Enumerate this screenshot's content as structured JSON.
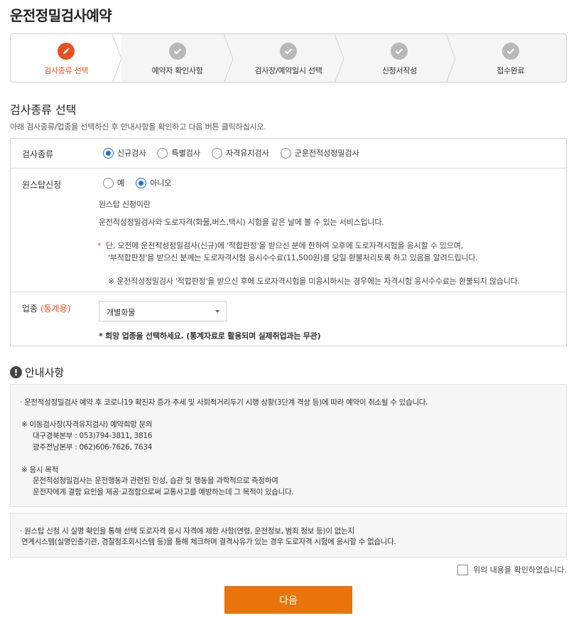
{
  "page_title": "운전정밀검사예약",
  "stepper": {
    "steps": [
      {
        "label": "검사종류 선택",
        "icon": "pencil-icon",
        "active": true
      },
      {
        "label": "예약자 확인사항",
        "icon": "check-icon",
        "active": false
      },
      {
        "label": "검사장/예약일시 선택",
        "icon": "check-icon",
        "active": false
      },
      {
        "label": "신청서작성",
        "icon": "check-icon",
        "active": false
      },
      {
        "label": "접수완료",
        "icon": "check-icon",
        "active": false
      }
    ]
  },
  "section": {
    "title": "검사종류 선택",
    "desc": "아래 검사종류/업종을 선택하신 후 안내사항을 확인하고 다음 버튼 클릭하십시오."
  },
  "form": {
    "exam_type": {
      "label": "검사종류",
      "options": [
        "신규검사",
        "특별검사",
        "자격유지검사",
        "군운전적성정밀검사"
      ],
      "selected": "신규검사"
    },
    "onestop": {
      "label": "원스탑신청",
      "options": [
        "예",
        "아니오"
      ],
      "selected": "아니오",
      "info_title": "원스탑 신청이란",
      "info_desc": "운전적성정밀검사와 도로자격(화물,버스,택시) 시험을 같은 날에 볼 수 있는 서비스입니다.",
      "notice_star": "*",
      "notice_line1": "단, 오전에 운전적성정밀검사(신규)에 '적합판정'을 받으신 분에 한하여 오후에 도로자격시험을 응시할 수 있으며,",
      "notice_line2": "'부적합판정'을 받으신 분께는 도로자격시험 응시수수료(11,500원)를 당일 환불처리토록 하고 있음을 알려드립니다.",
      "notice_line3": "※ 운전적성정밀검사 '적합판정'을 받으신 후에 도로자격시험을 미응시하시는 경우에는 자격시험 응시수수료는 환불되지 않습니다."
    },
    "industry": {
      "label": "업종",
      "label_suffix": "(통계용)",
      "value": "개별화물",
      "note": "* 희망 업종을 선택하세요. (통계자료로 활용되며 실제취업과는 무관)"
    }
  },
  "guide": {
    "title": "안내사항",
    "box1": {
      "line1": "· 운전적성정밀검사 예약 후 코로나19 확진자 증가 추세 및 사회적거리두기 시행 상황(3단계 격상 등)에 따라 예약이 취소될 수 있습니다.",
      "line2": "※ 이동검사장(자격유지검사) 예약희망 문의",
      "line3": "대구경북본부 : 053)794-3811, 3816",
      "line4": "광주전남본부 : 062)606-7626, 7634",
      "line5": "※ 응시 목적",
      "line6": "운전적성정밀검사는 운전행동과 관련된 인성, 습관 및 행동을 과학적으로 측정하여",
      "line7": "운전자에게 결함 요인을 제공·교정함으로써 교통사고를 예방하는데 그 목적이 있습니다."
    },
    "box2": {
      "line1": "· 원스탑 신청 시 실명 확인을 통해 선택 도로자격 응시 자격에 제한 사항(연령, 운전정보, 범죄 정보 등)이 없는지",
      "line2": "연계시스템(실명인증기관, 경찰청조회시스템 등)을 통해 체크하며 결격사유가 있는 경우 도로자격 시험에 응시할 수 없습니다."
    }
  },
  "confirm_label": "위의 내용을 확인하였습니다.",
  "next_label": "다음",
  "colors": {
    "accent": "#e8501f",
    "button": "#e8740b",
    "radio": "#1a6fd6"
  }
}
